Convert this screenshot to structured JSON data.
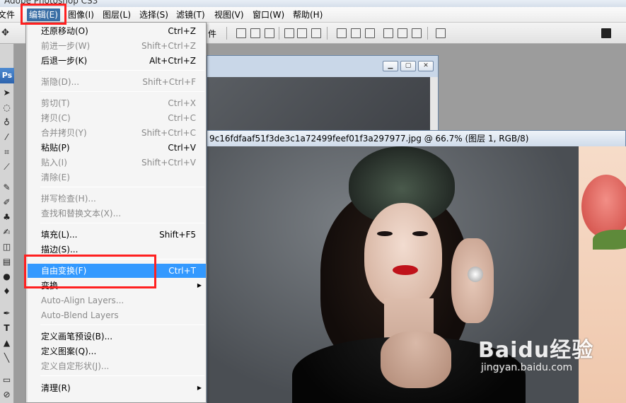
{
  "app": {
    "title_partial": "Adobe Photoshop CS3"
  },
  "menubar": {
    "items": [
      "文件",
      "编辑(E)",
      "图像(I)",
      "图层(L)",
      "选择(S)",
      "滤镜(T)",
      "视图(V)",
      "窗口(W)",
      "帮助(H)"
    ]
  },
  "optionsbar": {
    "partial_label": "件"
  },
  "toolbox": {
    "logo": "Ps"
  },
  "document": {
    "title": "9c16fdfaaf51f3de3c1a72499feef01f3a297977.jpg @ 66.7% (图层 1, RGB/8)"
  },
  "edit_menu": {
    "items": [
      {
        "label": "还原移动(O)",
        "shortcut": "Ctrl+Z",
        "disabled": false
      },
      {
        "label": "前进一步(W)",
        "shortcut": "Shift+Ctrl+Z",
        "disabled": true
      },
      {
        "label": "后退一步(K)",
        "shortcut": "Alt+Ctrl+Z",
        "disabled": false
      },
      {
        "label": "渐隐(D)...",
        "shortcut": "Shift+Ctrl+F",
        "disabled": true
      },
      {
        "label": "剪切(T)",
        "shortcut": "Ctrl+X",
        "disabled": true
      },
      {
        "label": "拷贝(C)",
        "shortcut": "Ctrl+C",
        "disabled": true
      },
      {
        "label": "合并拷贝(Y)",
        "shortcut": "Shift+Ctrl+C",
        "disabled": true
      },
      {
        "label": "粘贴(P)",
        "shortcut": "Ctrl+V",
        "disabled": false
      },
      {
        "label": "贴入(I)",
        "shortcut": "Shift+Ctrl+V",
        "disabled": true
      },
      {
        "label": "清除(E)",
        "shortcut": "",
        "disabled": true
      },
      {
        "label": "拼写检查(H)...",
        "shortcut": "",
        "disabled": true
      },
      {
        "label": "查找和替换文本(X)...",
        "shortcut": "",
        "disabled": true
      },
      {
        "label": "填充(L)...",
        "shortcut": "Shift+F5",
        "disabled": false
      },
      {
        "label": "描边(S)...",
        "shortcut": "",
        "disabled": false
      },
      {
        "label": "自由变换(F)",
        "shortcut": "Ctrl+T",
        "disabled": false,
        "selected": true
      },
      {
        "label": "变换",
        "shortcut": "",
        "disabled": false,
        "submenu": true
      },
      {
        "label": "Auto-Align Layers...",
        "shortcut": "",
        "disabled": true
      },
      {
        "label": "Auto-Blend Layers",
        "shortcut": "",
        "disabled": true
      },
      {
        "label": "定义画笔预设(B)...",
        "shortcut": "",
        "disabled": false
      },
      {
        "label": "定义图案(Q)...",
        "shortcut": "",
        "disabled": false
      },
      {
        "label": "定义自定形状(J)...",
        "shortcut": "",
        "disabled": true
      },
      {
        "label": "清理(R)",
        "shortcut": "",
        "disabled": false,
        "submenu": true
      }
    ]
  },
  "watermark": {
    "main": "Baidu经验",
    "sub": "jingyan.baidu.com"
  },
  "colors": {
    "highlight_box": "#ff2020",
    "menu_selected": "#3399ff",
    "menubar_active": "#3a6ea5"
  }
}
